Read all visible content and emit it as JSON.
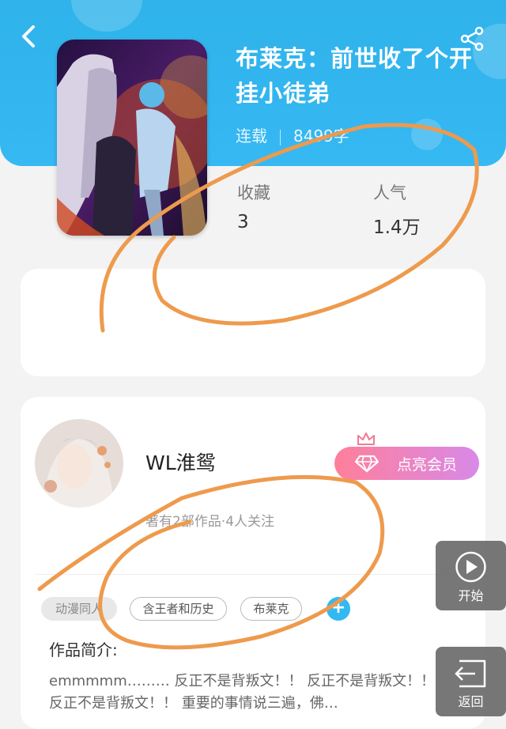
{
  "header": {
    "title": "布莱克：前世收了个开挂小徒弟",
    "status": "连载",
    "word_count": "8499字",
    "back_icon": "back-chevron-icon",
    "share_icon": "share-icon",
    "bg_color": "#36b8f3"
  },
  "stats": {
    "favorites_label": "收藏",
    "favorites_value": "3",
    "popularity_label": "人气",
    "popularity_value": "1.4万"
  },
  "author": {
    "name": "WL淮鸳",
    "stats": "著有2部作品·4人关注",
    "vip_button": "点亮会员"
  },
  "tags": [
    "动漫同人",
    "含王者和历史",
    "布莱克"
  ],
  "intro": {
    "title": "作品简介:",
    "text": "emmmmm……… 反正不是背叛文！！ 反正不是背叛文！！ 反正不是背叛文！！ 重要的事情说三遍，佛…"
  },
  "float_buttons": {
    "start_label": "开始",
    "return_label": "返回"
  },
  "colors": {
    "accent": "#33b9f2",
    "annotation": "#ee9a4d"
  }
}
